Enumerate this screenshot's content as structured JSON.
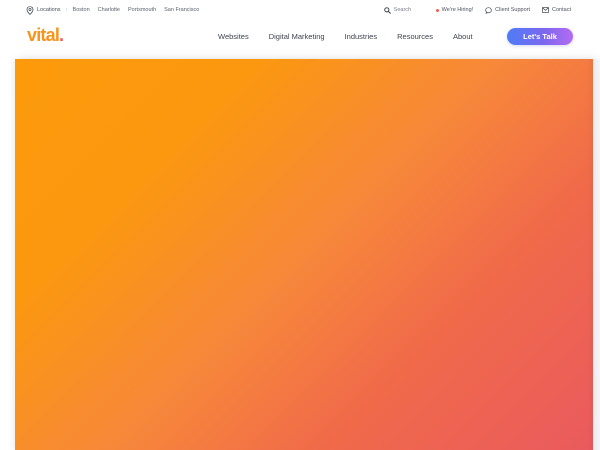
{
  "topbar": {
    "locations_label": "Locations",
    "cities": [
      "Boston",
      "Charlotte",
      "Portsmouth",
      "San Francisco"
    ],
    "search_placeholder": "Search",
    "hiring_label": "We're Hiring!",
    "support_label": "Client Support",
    "contact_label": "Contact"
  },
  "navbar": {
    "logo_text": "vital",
    "logo_dot": ".",
    "items": [
      "Websites",
      "Digital Marketing",
      "Industries",
      "Resources",
      "About"
    ],
    "cta_label": "Let's Talk"
  },
  "colors": {
    "brand_orange": "#f7941d",
    "brand_red": "#ef5b5b",
    "cta_blue": "#4f7cf7",
    "cta_purple": "#b36bf2",
    "hero_start": "#fd9a0c",
    "hero_end": "#ea5a5e"
  },
  "icons": {
    "location": "location-pin-icon",
    "search": "search-icon",
    "hiring": "hiring-dot-icon",
    "support": "chat-bubble-icon",
    "contact": "envelope-icon"
  }
}
